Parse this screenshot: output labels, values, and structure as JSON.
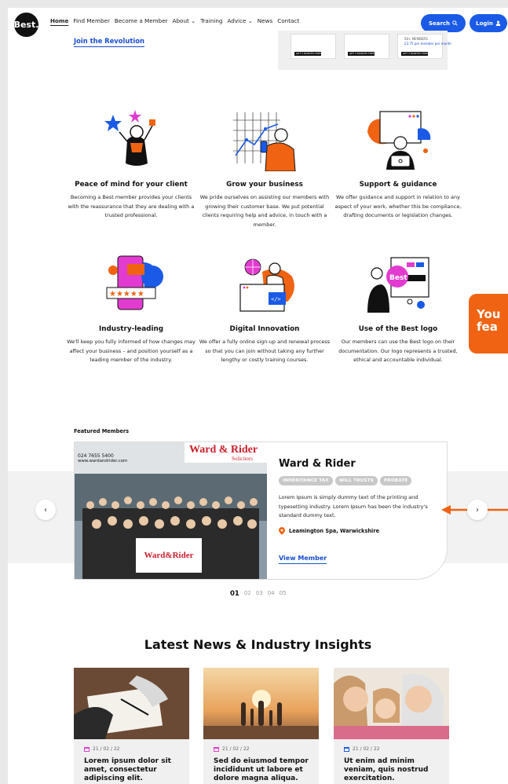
{
  "colors": {
    "brand_blue": "#1a5ae6",
    "accent_orange": "#f06312",
    "pink": "#e23bd0"
  },
  "nav": {
    "logo": "Best.",
    "links": [
      "Home",
      "Find Member",
      "Become a Member",
      "About ⌄",
      "Training",
      "Advice ⌄",
      "News",
      "Contact"
    ],
    "search_label": "Search",
    "login_label": "Login"
  },
  "hero": {
    "join_link": "Join the Revolution",
    "promo": {
      "cards": [
        {
          "tag": "GET 3 MONTHS FREE"
        },
        {
          "tag": "GET 3 MONTHS FREE"
        },
        {
          "tag": "GET 3 MONTHS FREE",
          "price": "£3.75 per member per month"
        }
      ],
      "members_label": "50+ MEMBERS"
    }
  },
  "features": [
    {
      "title": "Peace of mind for your client",
      "body": "Becoming a Best member provides your clients with the reassurance that they are dealing with a trusted professional."
    },
    {
      "title": "Grow your business",
      "body": "We pride ourselves on assisting our members with growing their customer base. We put potential clients requiring help and advice, in touch with a member."
    },
    {
      "title": "Support & guidance",
      "body": "We offer guidance and support in relation to any aspect of your work, whether this be compliance, drafting documents or legislation changes."
    },
    {
      "title": "Industry-leading",
      "body": "We'll keep you fully informed of how changes may affect your business – and position yourself as a leading member of the industry."
    },
    {
      "title": "Digital Innovation",
      "body": "We offer a fully online sign-up and renewal process so that you can join without taking any further lengthy or costly training courses."
    },
    {
      "title": "Use of the Best logo",
      "body": "Our members can use the Best logo on their documentation. Our logo represents a trusted, ethical and accountable individual."
    }
  ],
  "side_tab": {
    "line1": "You",
    "line2": "fea"
  },
  "featured": {
    "section_label": "Featured Members",
    "photo_phone": "024 7655 5400",
    "photo_web": "www.wardandrider.com",
    "photo_sign": "Ward & Rider",
    "photo_sign_sub": "Solicitors",
    "photo_logo": "Ward&Rider",
    "name": "Ward & Rider",
    "tags": [
      "INHERITANCE TAX",
      "WILL TRUSTS",
      "PROBATE"
    ],
    "description": "Lorem Ipsum is simply dummy text of the printing and typesetting industry. Lorem Ipsum has been the industry's standard dummy text.",
    "location": "Leamington Spa, Warwickshire",
    "view_link": "View Member",
    "pages": [
      "01",
      "02",
      "03",
      "04",
      "05"
    ],
    "current_page": "01"
  },
  "news": {
    "heading": "Latest News & Industry Insights",
    "items": [
      {
        "date": "21 / 02 / 22",
        "title": "Lorem ipsum dolor sit amet, consectetur adipiscing elit."
      },
      {
        "date": "21 / 02 / 22",
        "title": "Sed do eiusmod tempor incididunt ut labore et dolore magna aliqua."
      },
      {
        "date": "21 / 02 / 22",
        "title": "Ut enim ad minim veniam, quis nostrud exercitation."
      }
    ]
  }
}
